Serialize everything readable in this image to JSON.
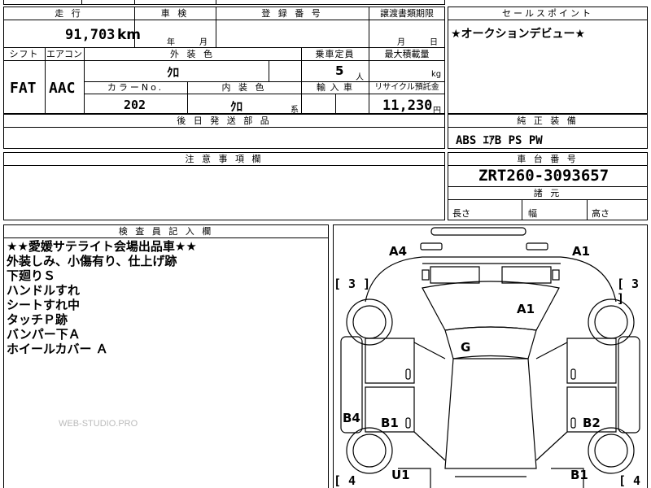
{
  "top_row_partial": "",
  "odometer": {
    "header": "走 行",
    "value": "91,703",
    "unit": "km"
  },
  "inspection": {
    "header": "車 検",
    "year_label": "年",
    "month_label": "月"
  },
  "registration": {
    "header": "登 録 番 号",
    "value": ""
  },
  "transfer_docs": {
    "header": "譲渡書類期限",
    "month_label": "月",
    "day_label": "日"
  },
  "sales_point": {
    "header": "セールスポイント",
    "text": "★オークションデビュー★"
  },
  "shift": {
    "header": "シフト",
    "value": "FAT"
  },
  "aircon": {
    "header": "エアコン",
    "value": "AAC"
  },
  "exterior_color": {
    "header": "外 装 色",
    "value": "ｸﾛ"
  },
  "capacity": {
    "header": "乗車定員",
    "value": "5",
    "unit": "人"
  },
  "max_load": {
    "header": "最大積載量",
    "value": "",
    "unit": "kg"
  },
  "color_no": {
    "header": "カラーNo.",
    "value": "202"
  },
  "interior_color": {
    "header": "内 装 色",
    "value": "ｸﾛ",
    "suffix": "系"
  },
  "import": {
    "header": "輸 入 車"
  },
  "recycle": {
    "header": "リサイクル預託金",
    "value": "11,230",
    "unit": "円"
  },
  "later_parts": {
    "header": "後 日 発 送 部 品",
    "value": ""
  },
  "genuine_equipment": {
    "header": "純 正 装 備",
    "value": "ABS ｴｱB PS PW"
  },
  "caution": {
    "header": "注 意 事 項 欄",
    "value": ""
  },
  "chassis": {
    "header": "車 台 番 号",
    "value": "ZRT260-3093657"
  },
  "dimensions": {
    "header": "諸 元",
    "length_label": "長さ",
    "width_label": "幅",
    "height_label": "高さ"
  },
  "inspector_notes": {
    "header": "検 査 員 記 入 欄",
    "lines": [
      "★★愛媛サテライト会場出品車★★",
      "外装しみ、小傷有り、仕上げ跡",
      "下廻りＳ",
      "ハンドルすれ",
      "シートすれ中",
      "タッチＰ跡",
      "バンパー下Ａ",
      "ホイールカバー Ａ"
    ],
    "watermark": "WEB-STUDIO.PRO"
  },
  "car_diagram": {
    "marks": {
      "a4": "A4",
      "a1_top": "A1",
      "a1_hood": "A1",
      "g": "G",
      "b4": "B4",
      "b1_left": "B1",
      "b2": "B2",
      "u1": "U1",
      "b1_bottom": "B1"
    },
    "brackets": {
      "front_left": "[ 3 ]",
      "front_right": "[ 3 ]",
      "rear_left": "[ 4",
      "rear_right": "[ 4"
    }
  }
}
